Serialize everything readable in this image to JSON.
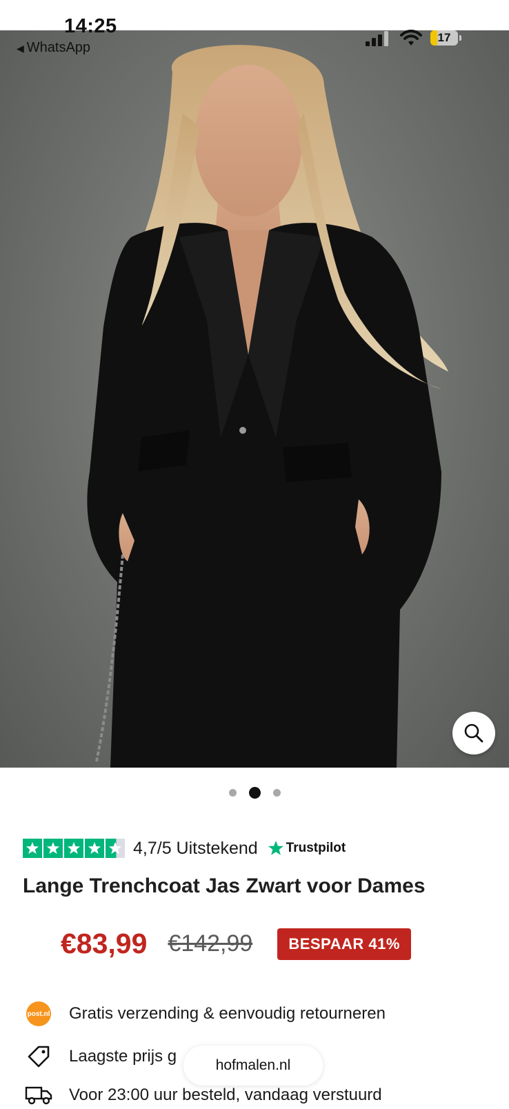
{
  "status_bar": {
    "time": "14:25",
    "back_app": "WhatsApp",
    "battery_level": "17"
  },
  "product": {
    "image_alt": "model-wearing-black-coat",
    "carousel": {
      "count": 3,
      "active_index": 1
    },
    "rating": {
      "score_text": "4,7/5 Uitstekend",
      "provider": "Trustpilot",
      "stars_filled": 4.5,
      "star_color": "#00b67a"
    },
    "title": "Lange Trenchcoat Jas Zwart voor Dames",
    "price": {
      "current": "€83,99",
      "original": "€142,99",
      "discount_badge": "BESPAAR 41%"
    },
    "usps": [
      {
        "icon": "postnl-icon",
        "icon_text": "post.nl",
        "text": "Gratis verzending & eenvoudig retourneren"
      },
      {
        "icon": "price-tag-icon",
        "text": "Laagste prijs g"
      },
      {
        "icon": "delivery-truck-icon",
        "text": "Voor 23:00 uur besteld, vandaag verstuurd"
      }
    ]
  },
  "browser": {
    "url": "hofmalen.nl"
  },
  "colors": {
    "price_red": "#c0261f",
    "trustpilot_green": "#00b67a",
    "postnl_orange": "#f7941d"
  }
}
